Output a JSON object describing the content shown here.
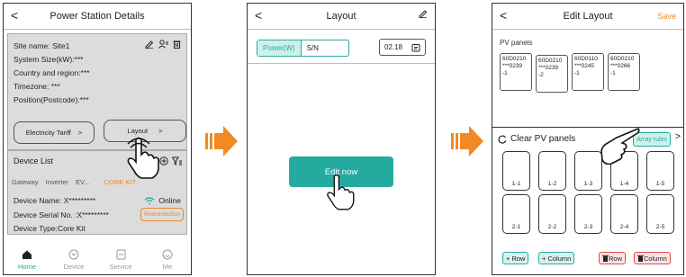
{
  "colors": {
    "accent": "#25aaa0",
    "orange": "#e8892a",
    "grey": "#dcdcdc",
    "red": "#e04a4a"
  },
  "screen1": {
    "back": "<",
    "title": "Power Station Details",
    "site_lines": [
      "Site name: Site1",
      "System Size(kW):***",
      "Country and region:***",
      "Timezone: ***",
      "Position(Postcode):***"
    ],
    "electricity_tariff": "Electricity Tariff",
    "electricity_arrow": ">",
    "layout": "Layout",
    "layout_arrow": ">",
    "device_list": "Device List",
    "tabs": [
      "Gateway",
      "Inverter",
      "EV...",
      "CORE KIT"
    ],
    "device_name": "Device Name: X*********",
    "online": "Online",
    "device_serial": "Device Serial No. :X*********",
    "redistribution": "Redistribution",
    "device_type": "Device Type:Core Kit",
    "nav": [
      "Home",
      "Device",
      "Service",
      "Me"
    ]
  },
  "screen2": {
    "back": "<",
    "title": "Layout",
    "seg": [
      "Power(W)",
      "S/N"
    ],
    "date": "02.18",
    "edit_now": "Edit now"
  },
  "screen3": {
    "back": "<",
    "title": "Edit Layout",
    "save": "Save",
    "pv_panels": "PV panels",
    "pvs": [
      {
        "l1": "60D0210",
        "l2": "***0239",
        "l3": "-1"
      },
      {
        "l1": "60D0210",
        "l2": "***0239",
        "l3": "-2"
      },
      {
        "l1": "60D0110",
        "l2": "***0245",
        "l3": "-1"
      },
      {
        "l1": "60D0210",
        "l2": "***0266",
        "l3": "-1"
      }
    ],
    "clear": "Clear PV panels",
    "array_rules": "Array rules",
    "more": ">",
    "slots_row1": [
      "1-1",
      "1-2",
      "1-3",
      "1-4",
      "1-5"
    ],
    "slots_row2": [
      "2-1",
      "2-2",
      "2-3",
      "2-4",
      "2-5"
    ],
    "add_row": "+ Row",
    "add_column": "+ Column",
    "del_row": "Row",
    "del_column": "Column"
  }
}
